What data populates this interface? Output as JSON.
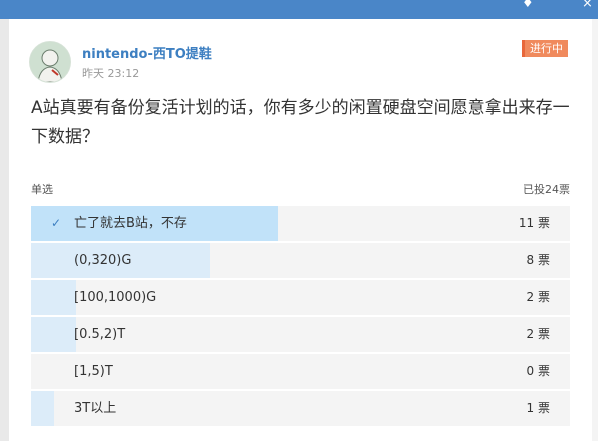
{
  "post": {
    "username": "nintendo-西TO提鞋",
    "time": "昨天 23:12",
    "status_badge": "进行中",
    "question": "A站真要有备份复活计划的话，你有多少的闲置硬盘空间愿意拿出来存一下数据？"
  },
  "poll": {
    "type_label": "单选",
    "total_label": "已投24票",
    "options": [
      {
        "label": "亡了就去B站，不存",
        "votes": "11 票",
        "fraction": 0.458,
        "selected": true
      },
      {
        "label": "(0,320)G",
        "votes": "8 票",
        "fraction": 0.333,
        "selected": false
      },
      {
        "label": "[100,1000)G",
        "votes": "2 票",
        "fraction": 0.083,
        "selected": false
      },
      {
        "label": "[0.5,2)T",
        "votes": "2 票",
        "fraction": 0.083,
        "selected": false
      },
      {
        "label": "[1,5)T",
        "votes": "0 票",
        "fraction": 0,
        "selected": false
      },
      {
        "label": "3T以上",
        "votes": "1 票",
        "fraction": 0.042,
        "selected": false
      }
    ]
  },
  "colors": {
    "accent": "#3d7fc1",
    "status_badge": "#f08a5d",
    "bar_selected": "#c1e2f9",
    "bar": "#dcecf9"
  },
  "icons": {
    "topbar": [
      "shirt-icon",
      "close-icon"
    ],
    "selected_option": "checkmark-icon"
  }
}
